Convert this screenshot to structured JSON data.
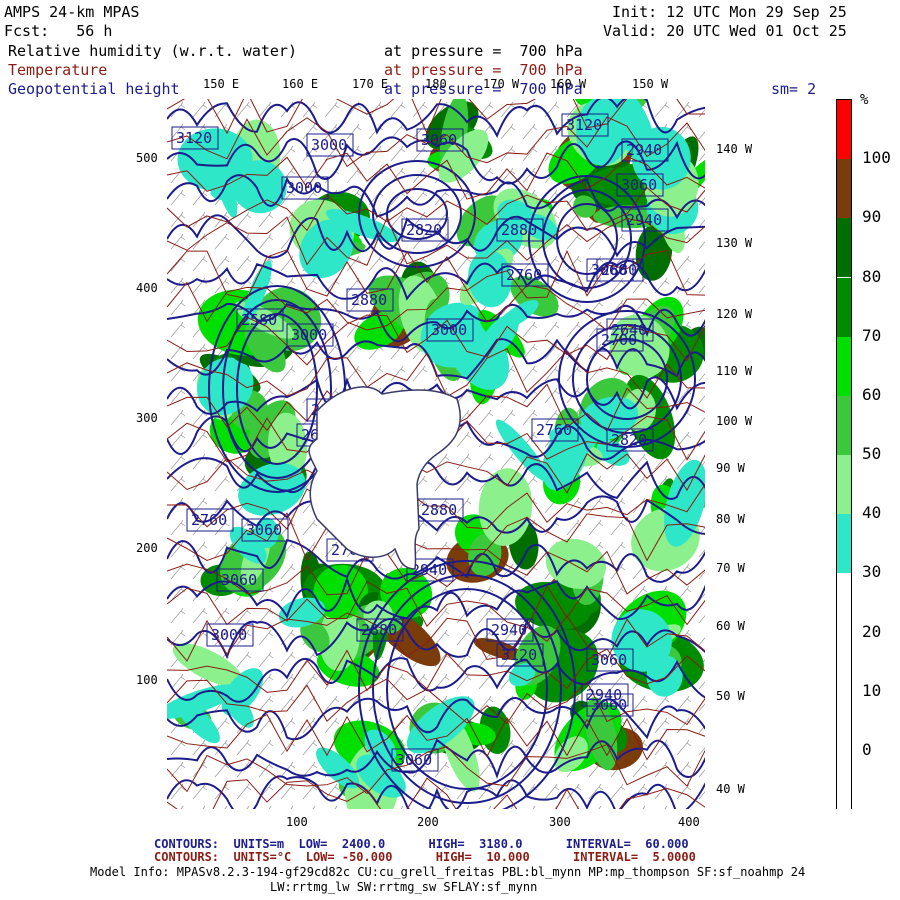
{
  "header": {
    "model": "AMPS 24-km MPAS",
    "fcst": "Fcst:   56 h",
    "init": "Init: 12 UTC Mon 29 Sep 25",
    "valid": "Valid: 20 UTC Wed 01 Oct 25",
    "field1_name": "Relative humidity (w.r.t. water)",
    "field1_level": "at pressure =  700 hPa",
    "field2_name": "Temperature",
    "field2_level": "at pressure =  700 hPa",
    "field3_name": "Geopotential height",
    "field3_level": "at pressure =  700 hPa",
    "smoothing": "sm= 2"
  },
  "map": {
    "top_lon_labels": [
      "150 E",
      "160 E",
      "170 E",
      "180",
      "170 W",
      "160 W",
      "150 W"
    ],
    "right_lon_labels": [
      "140 W",
      "130 W",
      "120 W",
      "110 W",
      "100 W",
      "90 W",
      "80 W",
      "70 W",
      "60 W",
      "50 W",
      "40 W"
    ],
    "y_ticks": [
      "500",
      "400",
      "300",
      "200",
      "100"
    ],
    "x_ticks": [
      "100",
      "200",
      "300",
      "400"
    ],
    "height_contour_labels": [
      "3120",
      "3000",
      "3060",
      "3120",
      "2940",
      "3000",
      "3060",
      "2820",
      "2880",
      "2940",
      "2880",
      "2760",
      "2880",
      "3000",
      "3060",
      "2700",
      "2640",
      "3000",
      "2640",
      "2580",
      "2640",
      "2820",
      "2760",
      "2760",
      "2820",
      "2700",
      "2760",
      "3060",
      "2880",
      "2940",
      "3060",
      "3000",
      "2880",
      "2940",
      "3120",
      "3060",
      "3060",
      "2940",
      "3060"
    ],
    "colors": {
      "land": "#ffffff",
      "coast": "#3a3a6a",
      "height_contour": "#1c1c8c",
      "temp_contour": "#8b1c14"
    }
  },
  "colorbar": {
    "unit": "%",
    "ticks": [
      "100",
      "90",
      "80",
      "70",
      "60",
      "50",
      "40",
      "30",
      "20",
      "10",
      "0"
    ],
    "segments": [
      {
        "from": 100,
        "to": 110,
        "color": "#ff0000"
      },
      {
        "from": 90,
        "to": 100,
        "color": "#7a3c0a"
      },
      {
        "from": 80,
        "to": 90,
        "color": "#006e00"
      },
      {
        "from": 70,
        "to": 80,
        "color": "#008c00"
      },
      {
        "from": 60,
        "to": 70,
        "color": "#00e000"
      },
      {
        "from": 50,
        "to": 60,
        "color": "#3cc83c"
      },
      {
        "from": 40,
        "to": 50,
        "color": "#8cf08c"
      },
      {
        "from": 30,
        "to": 40,
        "color": "#2ee6c8"
      },
      {
        "from": 20,
        "to": 30,
        "color": "#ffffff"
      },
      {
        "from": 10,
        "to": 20,
        "color": "#ffffff"
      },
      {
        "from": 0,
        "to": 10,
        "color": "#ffffff"
      },
      {
        "from": -10,
        "to": 0,
        "color": "#ffffff"
      }
    ]
  },
  "footer": {
    "contours1": "CONTOURS:  UNITS=m  LOW=  2400.0      HIGH=  3180.0      INTERVAL=  60.000",
    "contours2": "CONTOURS:  UNITS=°C  LOW= -50.000      HIGH=  10.000      INTERVAL=  5.0000",
    "model_info": "Model Info: MPASv8.2.3-194-gf29cd82c CU:cu_grell_freitas PBL:bl_mynn MP:mp_thompson SF:sf_noahmp 24",
    "model_info2": "LW:rrtmg_lw SW:rrtmg_sw SFLAY:sf_mynn"
  }
}
